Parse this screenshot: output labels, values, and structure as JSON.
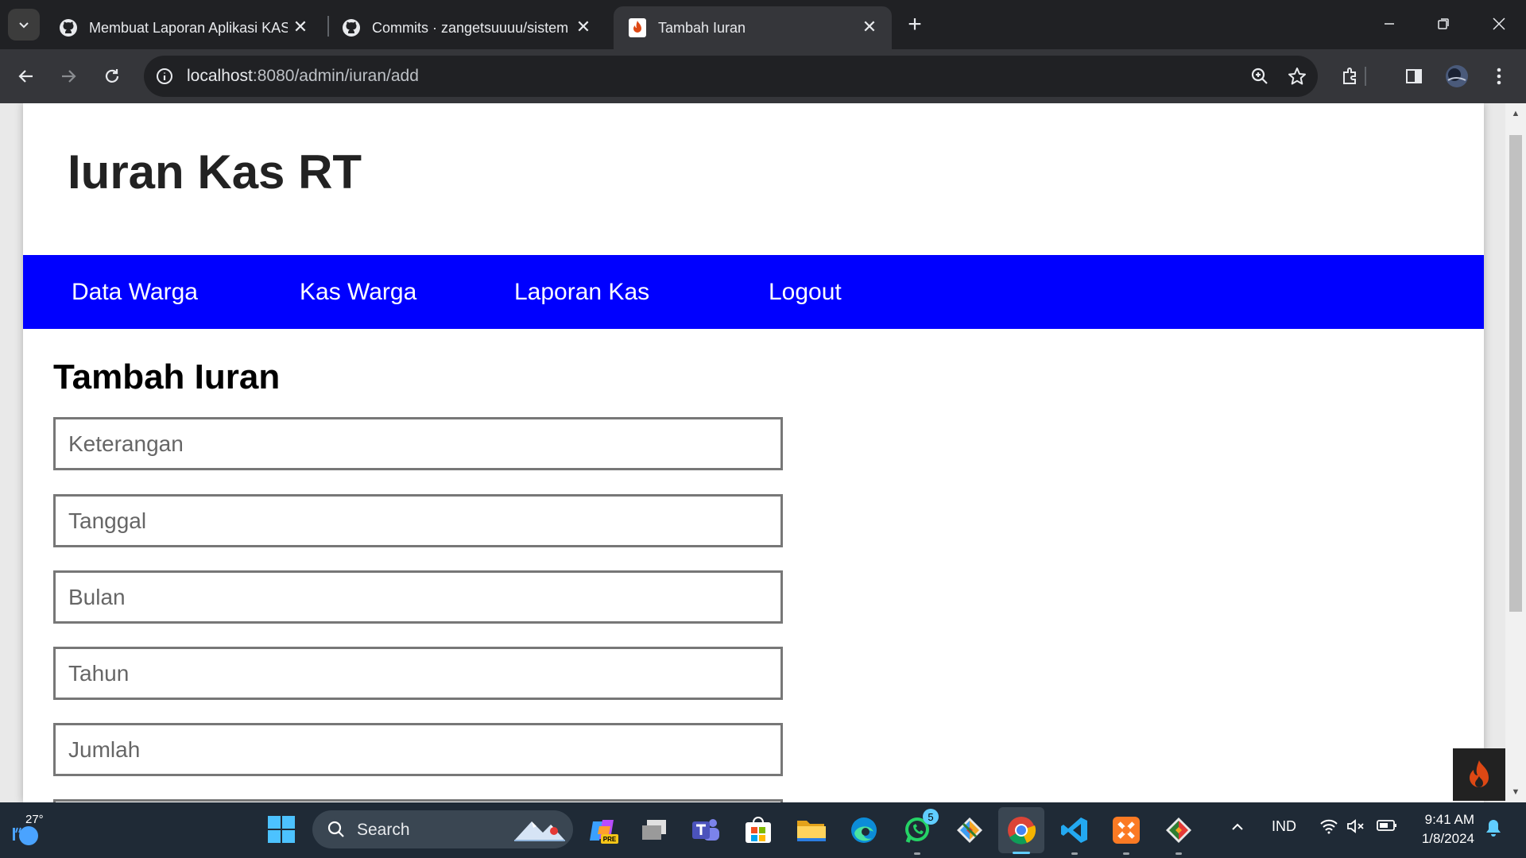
{
  "browser": {
    "tabs": [
      {
        "title": "Membuat Laporan Aplikasi KAS",
        "active": false
      },
      {
        "title": "Commits · zangetsuuuu/sistem",
        "active": false
      },
      {
        "title": "Tambah Iuran",
        "active": true
      }
    ],
    "url_host": "localhost",
    "url_rest": ":8080/admin/iuran/add"
  },
  "site": {
    "title": "Iuran Kas RT",
    "nav": [
      "Data Warga",
      "Kas Warga",
      "Laporan Kas",
      "Logout"
    ]
  },
  "form": {
    "title": "Tambah Iuran",
    "fields": [
      {
        "placeholder": "Keterangan"
      },
      {
        "placeholder": "Tanggal"
      },
      {
        "placeholder": "Bulan"
      },
      {
        "placeholder": "Tahun"
      },
      {
        "placeholder": "Jumlah"
      }
    ]
  },
  "taskbar": {
    "temperature": "27°",
    "search_label": "Search",
    "language": "IND",
    "time": "9:41 AM",
    "date": "1/8/2024",
    "whatsapp_badge": "5",
    "copilot_badge": "PRE"
  },
  "colors": {
    "nav_bg": "#0000ff",
    "accent": "#60cdff"
  }
}
